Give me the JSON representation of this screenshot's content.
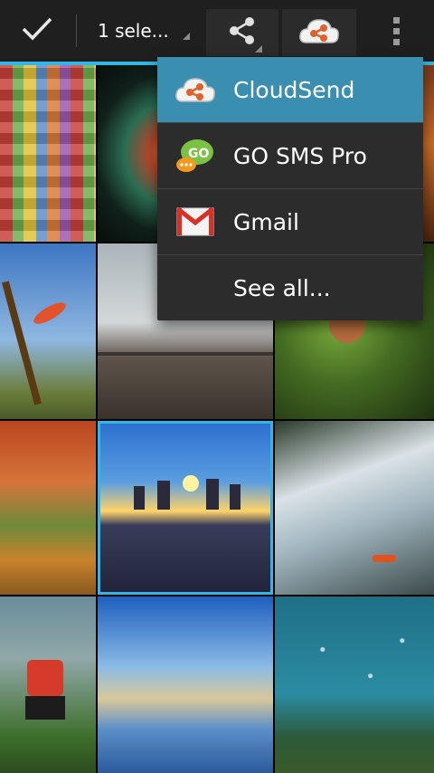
{
  "action_bar": {
    "selection_label": "1 sele...",
    "accent": "#33b5e5"
  },
  "icons": {
    "done": "checkmark-icon",
    "share": "share-icon",
    "cloudsend": "cloudsend-icon",
    "overflow": "overflow-menu-icon"
  },
  "share_menu": {
    "items": [
      {
        "label": "CloudSend",
        "icon": "cloudsend-icon",
        "highlighted": true
      },
      {
        "label": "GO SMS Pro",
        "icon": "go-sms-pro-icon"
      },
      {
        "label": "Gmail",
        "icon": "gmail-icon"
      },
      {
        "label": "See all...",
        "icon": ""
      }
    ]
  },
  "gallery": {
    "columns": 3,
    "selected_index": 7,
    "photos": [
      "colorful-knit-blanket",
      "crab-nebula",
      "autumn-forest",
      "red-flowers-hummingbird",
      "geyser-boardwalk",
      "bird-on-branch",
      "red-rock-canyon-river",
      "stonehenge-sunrise-crowd",
      "waterfall-kayaker",
      "soccer-player",
      "river-to-sea",
      "boats-on-lake"
    ]
  }
}
